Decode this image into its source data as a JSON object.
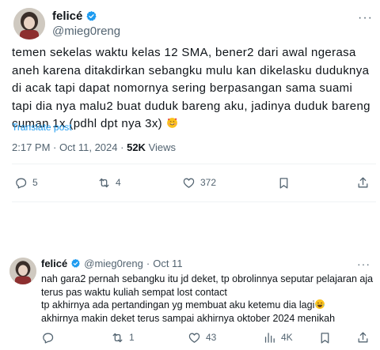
{
  "tweet1": {
    "display_name": "felicé",
    "handle": "@mieg0reng",
    "body": "temen sekelas waktu kelas 12 SMA, bener2 dari awal ngerasa aneh karena ditakdirkan sebangku mulu kan dikelasku duduknya di acak tapi dapat nomornya sering berpasangan sama suami tapi dia nya malu2 buat duduk bareng aku, jadinya duduk bareng cuman 1x (pdhl dpt nya 3x)",
    "emoji": "smiling-face-with-hearts",
    "translate": "Translate post",
    "time": "2:17 PM",
    "date": "Oct 11, 2024",
    "views": "52K",
    "views_label": "Views",
    "separator": "·",
    "actions": {
      "replies": "5",
      "reposts": "4",
      "likes": "372"
    }
  },
  "tweet2": {
    "display_name": "felicé",
    "handle": "@mieg0reng",
    "separator": "·",
    "date": "Oct 11",
    "lines": [
      "nah gara2 pernah sebangku itu jd deket, tp obrolinnya seputar pelajaran aja",
      "terus pas waktu kuliah sempat lost contact",
      "tp akhirnya ada pertandingan yg membuat aku ketemu dia lagi",
      "akhirnya makin deket terus sampai akhirnya oktober 2024 menikah"
    ],
    "emoji": "face-with-tears-of-joy",
    "actions": {
      "replies": "",
      "reposts": "1",
      "likes": "43",
      "views": "4K"
    }
  },
  "colors": {
    "text": "#0f1419",
    "muted": "#536471",
    "link": "#1d9bf0",
    "verified": "#1d9bf0",
    "divider": "#eff3f4"
  },
  "icons": [
    "verified-badge",
    "more-icon",
    "reply-icon",
    "repost-icon",
    "like-icon",
    "views-icon",
    "bookmark-icon",
    "share-icon"
  ]
}
